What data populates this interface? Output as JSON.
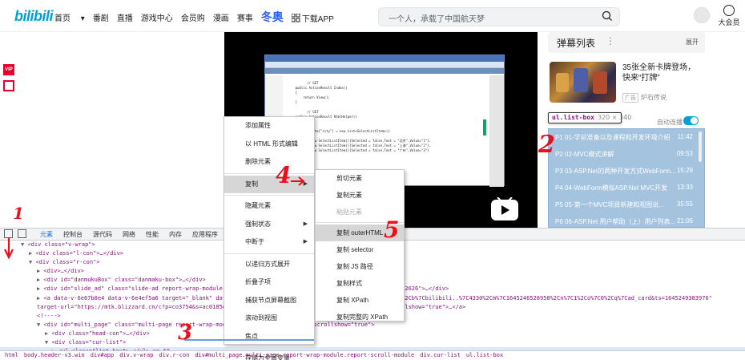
{
  "header": {
    "logo": "bilibili",
    "nav": [
      "首页",
      "番剧",
      "直播",
      "游戏中心",
      "会员购",
      "漫画",
      "赛事"
    ],
    "winter": "冬奥",
    "download": "下载APP",
    "search_placeholder": "一个人，承载了中国航天梦",
    "vip_label": "大会员"
  },
  "left": {
    "vip_badge": "VIP"
  },
  "side": {
    "danmu_title": "弹幕列表",
    "danmu_dots": "⋮",
    "danmu_expand": "展开",
    "ad_title": "35张全新卡牌登场，快来“打牌”",
    "ad_tag": "广告",
    "ad_source": "炉石传说",
    "tooltip_selector": "ul.list-box",
    "tooltip_size": "320 × 340",
    "autoplay": "自动连播",
    "playlist": [
      {
        "label": "P1  01-学前准备以及课程和开发环境介绍",
        "duration": "11:42"
      },
      {
        "label": "P2  02-MVC模式讲解",
        "duration": "09:53"
      },
      {
        "label": "P3  03-ASP.Net的两种开发方式WebForm...",
        "duration": "15:29"
      },
      {
        "label": "P4  04-WebForm模拟ASP.Net MVC开发",
        "duration": "13:33"
      },
      {
        "label": "P5  05-第一个MVC项目新建和视图说...",
        "duration": "35:55"
      },
      {
        "label": "P6  06-ASP.Net 用户帮助（上）用户列表...",
        "duration": "21:06"
      }
    ]
  },
  "video": {
    "window_title": "Mvc.UserDemo - Microsoft Visual Studio(管理员)",
    "code_lines": [
      "          // GET",
      "    public ActionResult Index()",
      "    {",
      "        return View();",
      "    }",
      "",
      "          // GET",
      "    public ActionResult HtmlHelper()",
      "    {",
      "",
      "        ViewData[\"city\"] = new List<SelectListItem>()",
      "        {",
      "            new SelectListItem(){Selected = false,Text = \"北京\",Value=\"1\"},",
      "            new SelectListItem(){Selected = false,Text = \"上海\",Value=\"2\"},",
      "            new SelectListItem(){Selected = false,Text = \"广州\",Value=\"3\"}",
      "        };"
    ],
    "line_numbers": [
      "13",
      "14",
      "15",
      "16",
      "17",
      "18",
      "19",
      "20",
      "21",
      "22"
    ]
  },
  "devtools": {
    "tabs": [
      "元素",
      "控制台",
      "源代码",
      "网络",
      "性能",
      "内存",
      "应用程序"
    ],
    "dom_lines": [
      {
        "indent": 1,
        "arrow": "▼",
        "html": "<div class=\"v-wrap\">"
      },
      {
        "indent": 2,
        "arrow": "▶",
        "html": "<div class=\"l-con\">…</div>"
      },
      {
        "indent": 2,
        "arrow": "▼",
        "html": "<div class=\"r-con\">"
      },
      {
        "indent": 3,
        "arrow": "▶",
        "html": "<div>…</div>"
      },
      {
        "indent": 3,
        "arrow": "▶",
        "html": "<div id=\"danmukuBox\" class=\"danmaku-box\">…</div>"
      },
      {
        "indent": 3,
        "arrow": "▶",
        "html": "<div id=\"slide_ad\" class=\"slide-ad report-wrap-module report-scroll-module\" scrollshow=\"true\" data-loc-id=\"2626\">…</div>"
      },
      {
        "indent": 3,
        "arrow": "▶",
        "html": "<a data-v-6e67b0e4 data-v-6e4ef5a6 target=\"_blank\" data-loc-id=\"4332\" class=\"... (link) ...v2?msg=a%7C4331%2Cb%7Cbilibili..%7C4330%2Cm%7C1645246528958%2Cn%7C1%2Co%7C0%2Cq%7Cad_card&ts=1645249383976\""
      },
      {
        "indent": 3,
        "arrow": "",
        "html": "target-url=\"https://mtk.blizzard.cn/c?p=co3754&s=ac0185eca6...\" class=\"... single report-scroll-module\" scrollshow=\"true\">…</a>"
      },
      {
        "indent": 3,
        "arrow": "",
        "html": "<!---->"
      },
      {
        "indent": 3,
        "arrow": "▼",
        "html": "<div id=\"multi_page\" class=\"multi-page report-wrap-module report-scroll-module\" scrollshow=\"true\">"
      },
      {
        "indent": 4,
        "arrow": "▶",
        "html": "<div class=\"head-con\">…</div>"
      },
      {
        "indent": 4,
        "arrow": "▼",
        "html": "<div class=\"cur-list\">"
      },
      {
        "indent": 5,
        "arrow": "▶",
        "html": "<ul class=\"list-box\">…</ul> == $0"
      }
    ],
    "breadcrumbs": [
      "html",
      "body.header-v3.win",
      "div#app",
      "div.v-wrap",
      "div.r-con",
      "div#multi_page.multi-page.report-wrap-module.report-scroll-module",
      "div.cur-list",
      "ul.list-box"
    ]
  },
  "menu1": [
    {
      "label": "添加属性"
    },
    {
      "label": "以 HTML 形式编辑"
    },
    {
      "label": "删除元素"
    },
    {
      "sep": true
    },
    {
      "label": "复制",
      "arrow": true,
      "highlight": true
    },
    {
      "sep": true
    },
    {
      "label": "隐藏元素"
    },
    {
      "label": "强制状态",
      "arrow": true
    },
    {
      "label": "中断于",
      "arrow": true
    },
    {
      "sep": true
    },
    {
      "label": "以递归方式展开"
    },
    {
      "label": "折叠子项"
    },
    {
      "label": "捕获节点屏幕截图"
    },
    {
      "label": "滚动到视图"
    },
    {
      "label": "焦点"
    },
    {
      "sep": true
    },
    {
      "label": "存储为全局变量"
    }
  ],
  "menu2": [
    {
      "label": "剪切元素"
    },
    {
      "label": "复制元素"
    },
    {
      "label": "粘贴元素",
      "disabled": true
    },
    {
      "sep": true
    },
    {
      "label": "复制 outerHTML",
      "highlight": true
    },
    {
      "label": "复制 selector"
    },
    {
      "label": "复制 JS 路径"
    },
    {
      "label": "复制样式"
    },
    {
      "label": "复制 XPath"
    },
    {
      "label": "复制完整的 XPath"
    }
  ],
  "annotations": [
    "1",
    "2",
    "3",
    "4",
    "5"
  ],
  "colors": {
    "accent": "#00a1d6",
    "annotation": "#e8101c",
    "playlist": "#a3c3df"
  }
}
